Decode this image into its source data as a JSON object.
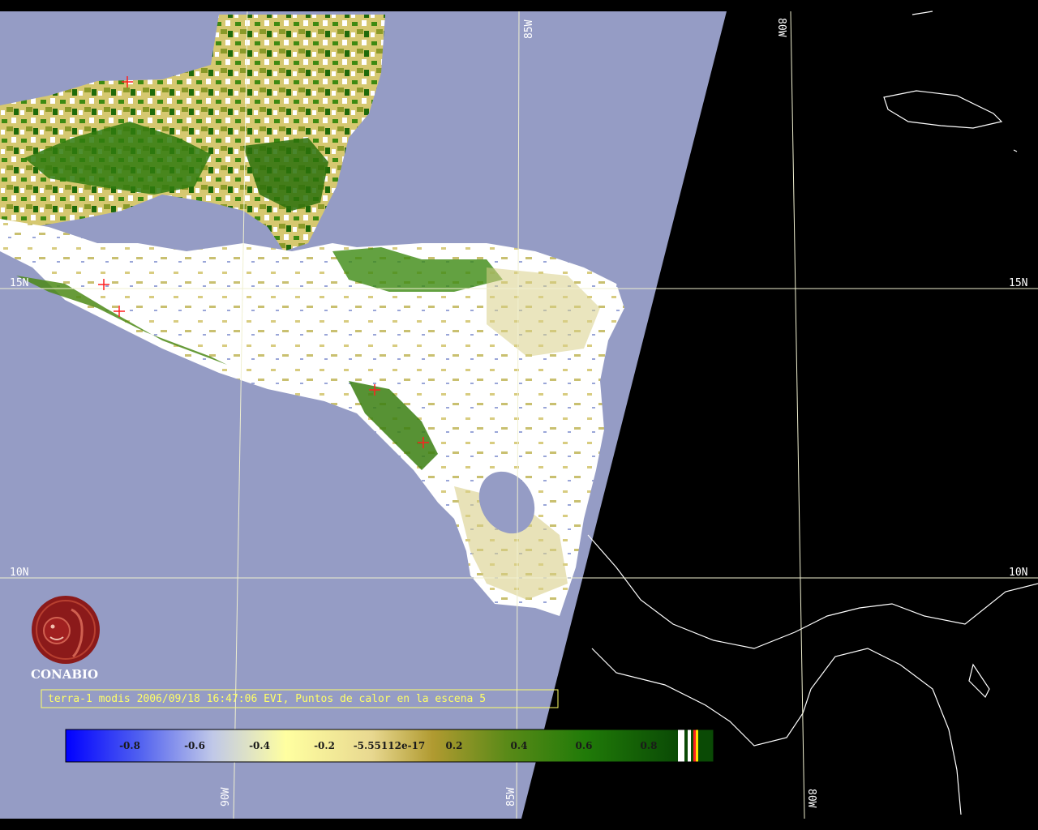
{
  "caption": "terra-1 modis 2006/09/18 16:47:06 EVI, Puntos de calor en la escena 5",
  "logo": {
    "name": "CONABIO",
    "icon": "conabio-emblem-icon"
  },
  "grid_labels": {
    "lat_15_left": "15N",
    "lat_15_right": "15N",
    "lat_10_left": "10N",
    "lat_10_right": "10N",
    "lon_85_top": "85W",
    "lon_80_top": "80W",
    "lon_90_bottom": "90W",
    "lon_85_bottom": "85W",
    "lon_80_bottom": "80W"
  },
  "colorbar": {
    "ticks": [
      "-0.8",
      "-0.6",
      "-0.4",
      "-0.2",
      "-5.55112e-17",
      "0.2",
      "0.4",
      "0.6",
      "0.8"
    ]
  },
  "colors": {
    "ocean": "#959cc5",
    "night": "#000000",
    "cloud": "#ffffff",
    "vegetation": "#2e7d10",
    "sparse_vegetation": "#c8b850",
    "hotspot": "#ff2020",
    "caption_text": "#ffff66",
    "graticule": "#f0f0d0"
  }
}
